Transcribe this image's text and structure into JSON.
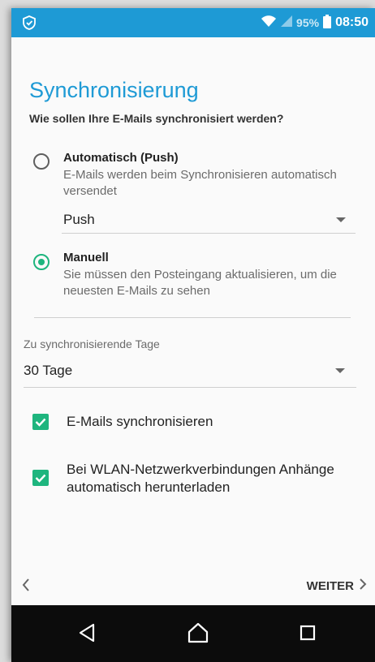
{
  "status_bar": {
    "battery_percent": "95%",
    "time": "08:50"
  },
  "page": {
    "title": "Synchronisierung",
    "subtitle": "Wie sollen Ihre E-Mails synchronisiert werden?"
  },
  "sync_options": [
    {
      "title": "Automatisch (Push)",
      "description": "E-Mails werden beim Synchronisieren automatisch versendet",
      "selected": false
    },
    {
      "title": "Manuell",
      "description": "Sie müssen den Posteingang aktualisieren, um die neuesten E-Mails zu sehen",
      "selected": true
    }
  ],
  "push_dropdown": {
    "value": "Push"
  },
  "days": {
    "label": "Zu synchronisierende Tage",
    "value": "30 Tage"
  },
  "checkboxes": [
    {
      "label": "E-Mails synchronisieren",
      "checked": true
    },
    {
      "label": "Bei WLAN-Netzwerkverbindungen Anhänge automatisch herunterladen",
      "checked": true
    }
  ],
  "footer": {
    "next_label": "WEITER"
  },
  "colors": {
    "accent_blue": "#1e9ad5",
    "accent_green": "#1eb57e",
    "nav_bar": "#0c0c0c"
  }
}
